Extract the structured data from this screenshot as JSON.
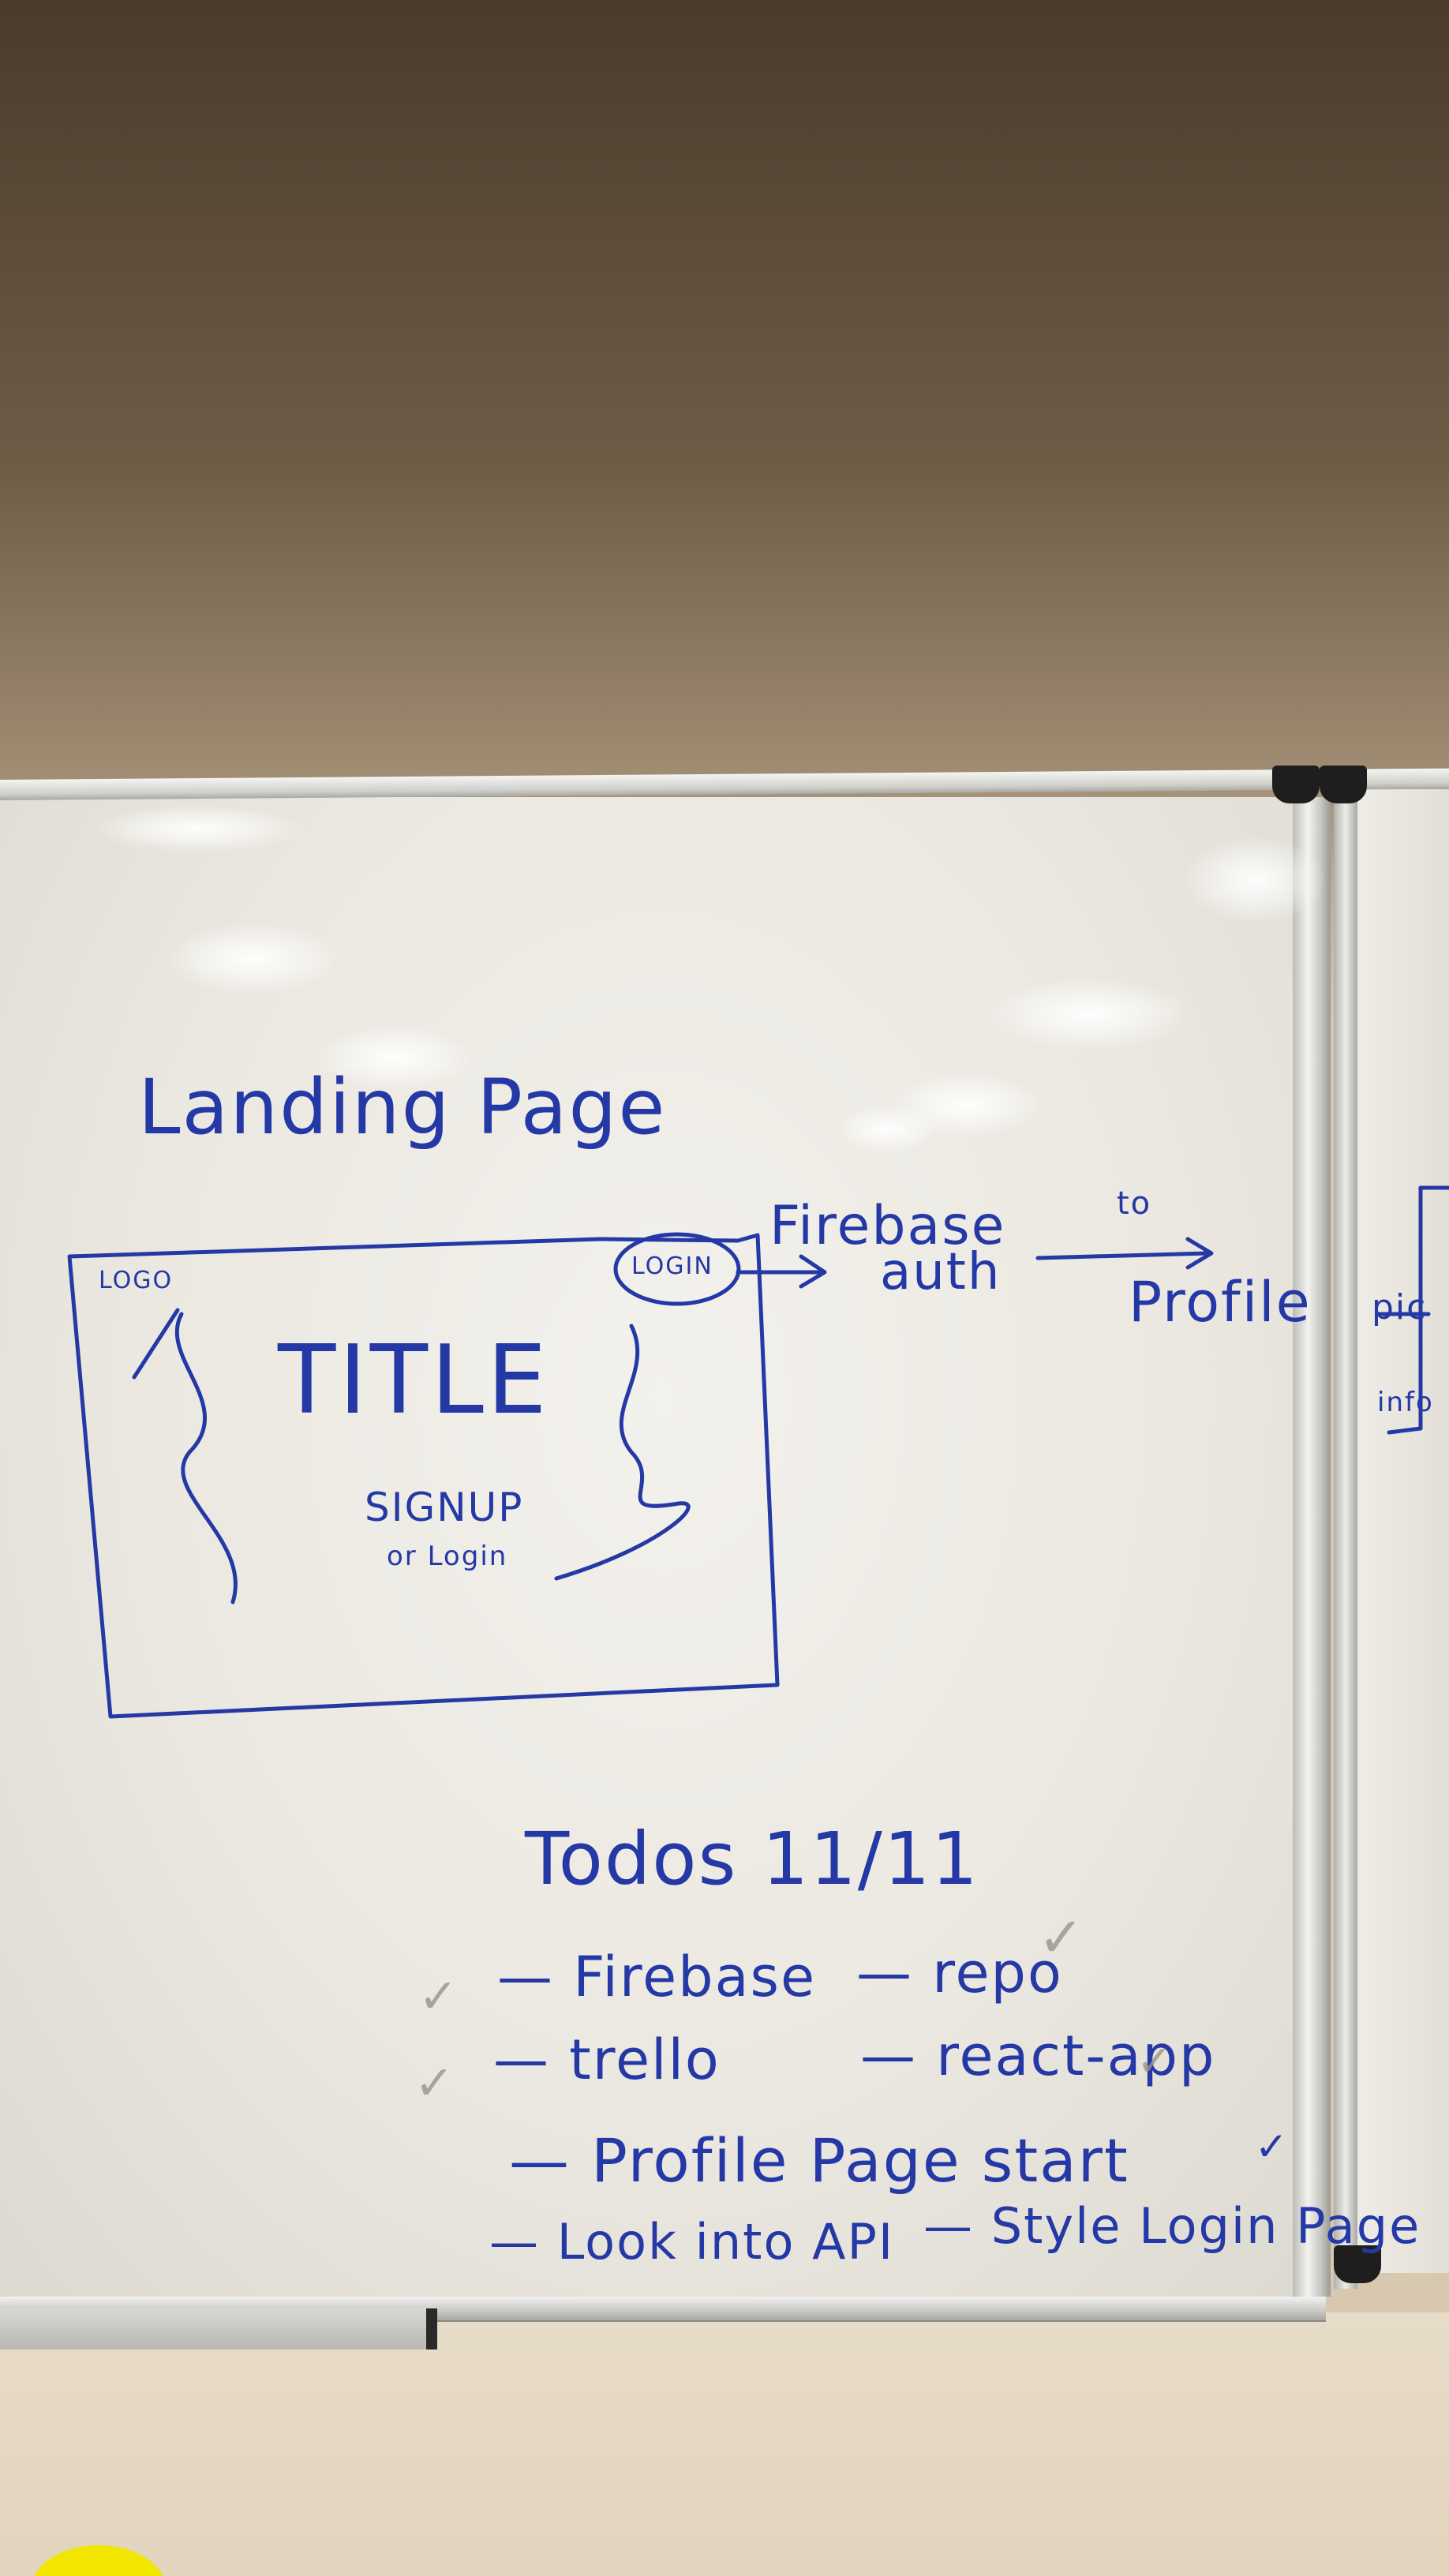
{
  "whiteboard": {
    "heading": "Landing Page",
    "wireframe": {
      "logo": "LOGO",
      "login_button": "LOGIN",
      "title": "TITLE",
      "signup": "SIGNUP",
      "or_login": "or Login"
    },
    "flow": {
      "firebase": "Firebase",
      "auth": "auth",
      "to": "to",
      "profile": "Profile"
    },
    "side_board": {
      "pic": "pic",
      "info": "info"
    },
    "todos": {
      "title": "Todos 11/11",
      "items": [
        "— Firebase",
        "— repo",
        "— trello",
        "— react-app",
        "— Profile Page start",
        "— Look into API",
        "— Style Login Page"
      ],
      "check_mark": "✓"
    }
  },
  "colors": {
    "marker_ink": "#2438a6",
    "whiteboard": "#ebe8e1",
    "wall": "#6e5c47"
  }
}
